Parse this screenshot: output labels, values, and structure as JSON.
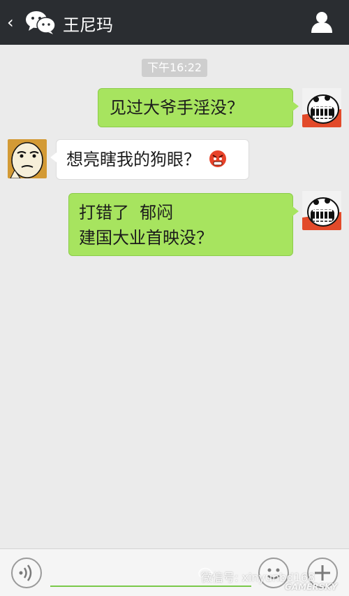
{
  "header": {
    "back_icon": "back-chevron-icon",
    "logo_icon": "wechat-logo-icon",
    "title": "王尼玛",
    "profile_icon": "person-icon"
  },
  "chat": {
    "timestamp": "下午16:22",
    "messages": [
      {
        "side": "right",
        "text": "见过大爷手淫没？"
      },
      {
        "side": "left",
        "text": "想亮瞎我的狗眼？",
        "emoji": "angry-face-emoji"
      },
      {
        "side": "right",
        "line1": "打错了  郁闷",
        "line2": "建国大业首映没？"
      }
    ]
  },
  "input_bar": {
    "voice_icon": "voice-wave-icon",
    "input_value": "",
    "emoji_icon": "smiley-icon",
    "plus_icon": "plus-icon"
  },
  "watermark": {
    "text": "微信号: xinyunbd168",
    "brand": "GAMERSKY"
  },
  "colors": {
    "header_bg": "#2a2d31",
    "sent_bubble": "#a7e45f",
    "received_bubble": "#ffffff",
    "chat_bg": "#ebebeb"
  }
}
